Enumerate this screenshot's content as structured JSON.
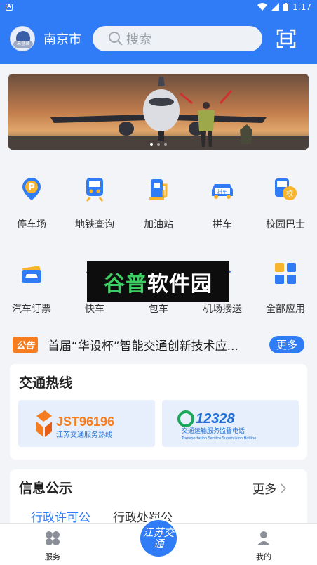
{
  "statusbar": {
    "time": "1:17"
  },
  "header": {
    "avatar_badge": "未登录",
    "city": "南京市",
    "search_placeholder": "搜索"
  },
  "banner": {
    "slides": 3,
    "active": 0
  },
  "services": [
    {
      "label": "停车场",
      "icon": "parking-icon"
    },
    {
      "label": "地铁查询",
      "icon": "metro-icon"
    },
    {
      "label": "加油站",
      "icon": "gas-station-icon"
    },
    {
      "label": "拼车",
      "icon": "carpool-icon"
    },
    {
      "label": "校园巴士",
      "icon": "school-bus-icon"
    },
    {
      "label": "汽车订票",
      "icon": "bus-ticket-icon"
    },
    {
      "label": "快车",
      "icon": "express-car-icon"
    },
    {
      "label": "包车",
      "icon": "charter-car-icon"
    },
    {
      "label": "机场接送",
      "icon": "airport-transfer-icon"
    },
    {
      "label": "全部应用",
      "icon": "all-apps-icon"
    }
  ],
  "watermark": {
    "part1": "谷普",
    "part2": "软件园"
  },
  "notice": {
    "tag": "公告",
    "text": "首届“华设杯”智能交通创新技术应...",
    "more": "更多"
  },
  "hotline": {
    "title": "交通热线",
    "items": [
      {
        "number": "JST96196",
        "caption": "江苏交通服务热线"
      },
      {
        "number": "12328",
        "caption": "交通运输服务监督电话",
        "caption_en": "Transportation Service Supervision Hotline"
      }
    ]
  },
  "info": {
    "title": "信息公示",
    "more": "更多",
    "tabs": [
      "行政许可公",
      "行政处罚公"
    ]
  },
  "bottomnav": {
    "service": "服务",
    "center": "江苏交通",
    "mine": "我的"
  },
  "colors": {
    "primary": "#2f7cf6",
    "notice_tag": "#f57c1f",
    "hotline_bg": "#e6effb"
  }
}
